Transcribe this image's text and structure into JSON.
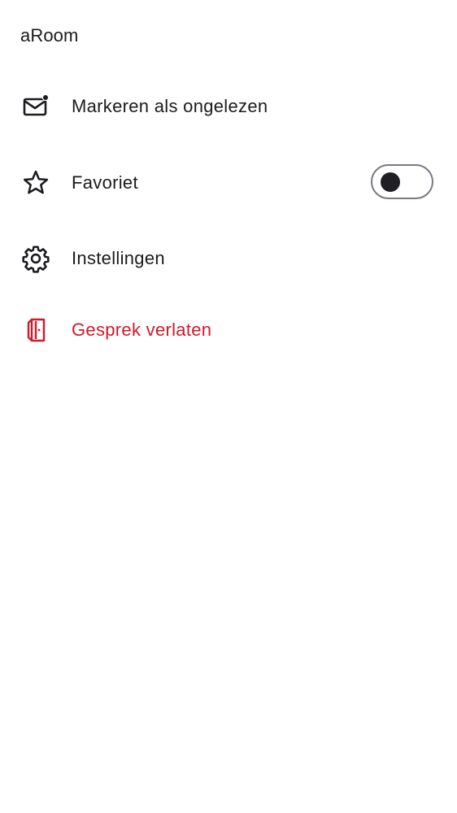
{
  "sheet": {
    "title": "aRoom"
  },
  "menu": {
    "mark_unread": {
      "label": "Markeren als ongelezen",
      "icon": "mail-unread-icon"
    },
    "favourite": {
      "label": "Favoriet",
      "icon": "star-outline-icon",
      "toggle_on": false
    },
    "settings": {
      "label": "Instellingen",
      "icon": "gear-icon"
    },
    "leave": {
      "label": "Gesprek verlaten",
      "icon": "door-leave-icon"
    }
  },
  "colors": {
    "text": "#1b1b1f",
    "danger": "#d0182a",
    "toggle_border": "#767a84",
    "toggle_knob": "#1f1f24"
  }
}
